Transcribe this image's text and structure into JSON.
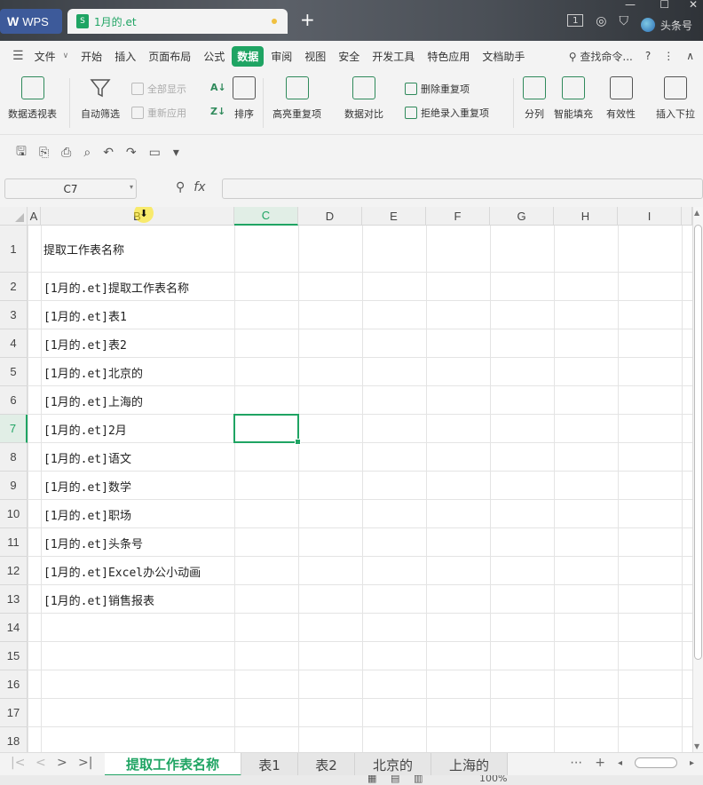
{
  "titlebar": {
    "app_label": "WPS",
    "file_tab": "1月的.et",
    "new_tab": "+",
    "sheet_badge": "1",
    "username": "头条号"
  },
  "menubar": {
    "items": [
      "文件",
      "开始",
      "插入",
      "页面布局",
      "公式",
      "数据",
      "审阅",
      "视图",
      "安全",
      "开发工具",
      "特色应用",
      "文档助手"
    ],
    "active_index": 5,
    "search_label": "查找命令...",
    "help": "?",
    "more": "⋮",
    "collapse": "∧"
  },
  "ribbon": {
    "pivot": "数据透视表",
    "autofilter": "自动筛选",
    "show_all": "全部显示",
    "reapply": "重新应用",
    "sort": "排序",
    "highlight_dup": "高亮重复项",
    "compare": "数据对比",
    "remove_dup": "删除重复项",
    "reject_dup": "拒绝录入重复项",
    "split": "分列",
    "smart_fill": "智能填充",
    "validation": "有效性",
    "insert_dropdown": "插入下拉"
  },
  "formula_bar": {
    "name_box": "C7",
    "fx": "fx",
    "formula": ""
  },
  "grid": {
    "columns": [
      "A",
      "B",
      "C",
      "D",
      "E",
      "F",
      "G",
      "H",
      "I"
    ],
    "selected_column": "C",
    "rows": [
      "1",
      "2",
      "3",
      "4",
      "5",
      "6",
      "7",
      "8",
      "9",
      "10",
      "11",
      "12",
      "13",
      "14",
      "15",
      "16",
      "17",
      "18"
    ],
    "selected_row": "7",
    "column_b": [
      "提取工作表名称",
      "[1月的.et]提取工作表名称",
      "[1月的.et]表1",
      "[1月的.et]表2",
      "[1月的.et]北京的",
      "[1月的.et]上海的",
      "[1月的.et]2月",
      "[1月的.et]语文",
      "[1月的.et]数学",
      "[1月的.et]职场",
      "[1月的.et]头条号",
      "[1月的.et]Excel办公小动画",
      "[1月的.et]销售报表",
      "",
      "",
      "",
      "",
      ""
    ]
  },
  "sheets": {
    "tabs": [
      "提取工作表名称",
      "表1",
      "表2",
      "北京的",
      "上海的"
    ],
    "active_index": 0,
    "more": "⋯",
    "add": "+"
  },
  "statusbar": {
    "zoom": "100%"
  }
}
